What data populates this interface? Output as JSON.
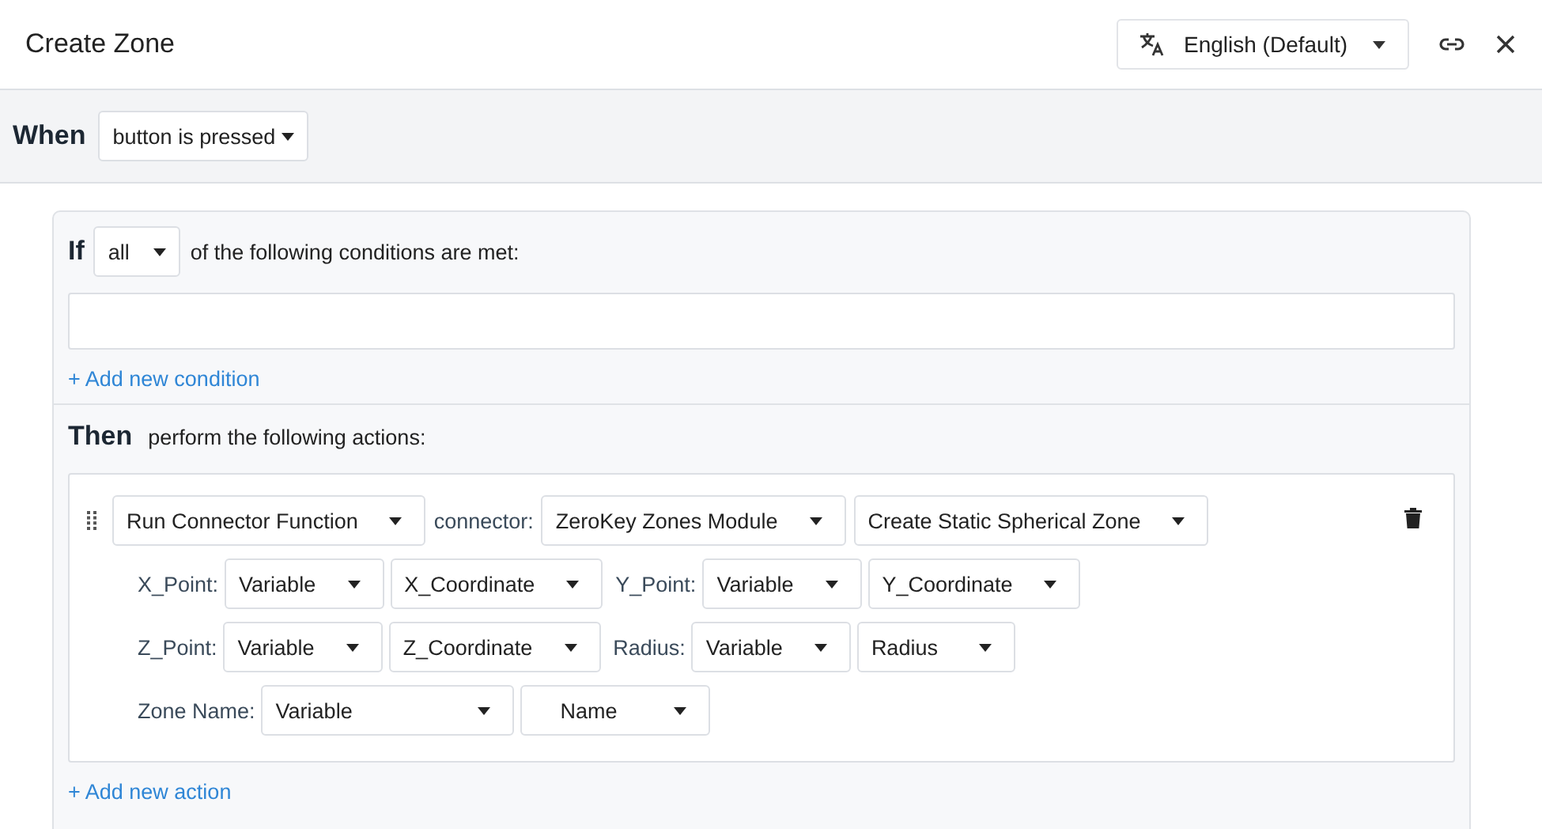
{
  "window": {
    "title": "Create Zone"
  },
  "header": {
    "language": "English (Default)"
  },
  "when": {
    "label": "When",
    "trigger": "button is pressed"
  },
  "if": {
    "label": "If",
    "quantifier": "all",
    "suffix": "of the following conditions are met:",
    "add_link": "+ Add new condition"
  },
  "then": {
    "label": "Then",
    "suffix": "perform the following actions:",
    "add_link": "+ Add new action",
    "actions": [
      {
        "function": "Run Connector Function",
        "connector_label": "connector:",
        "connector": "ZeroKey Zones Module",
        "operation": "Create Static Spherical Zone",
        "param_lines": [
          {
            "params": [
              {
                "label": "X_Point:",
                "source": "Variable",
                "value": "X_Coordinate"
              },
              {
                "label": "Y_Point:",
                "source": "Variable",
                "value": "Y_Coordinate"
              }
            ]
          },
          {
            "params": [
              {
                "label": "Z_Point:",
                "source": "Variable",
                "value": "Z_Coordinate"
              },
              {
                "label": "Radius:",
                "source": "Variable",
                "value": "Radius"
              }
            ]
          },
          {
            "params": [
              {
                "label": "Zone Name:",
                "source": "Variable",
                "value": "Name"
              }
            ]
          }
        ]
      }
    ]
  }
}
